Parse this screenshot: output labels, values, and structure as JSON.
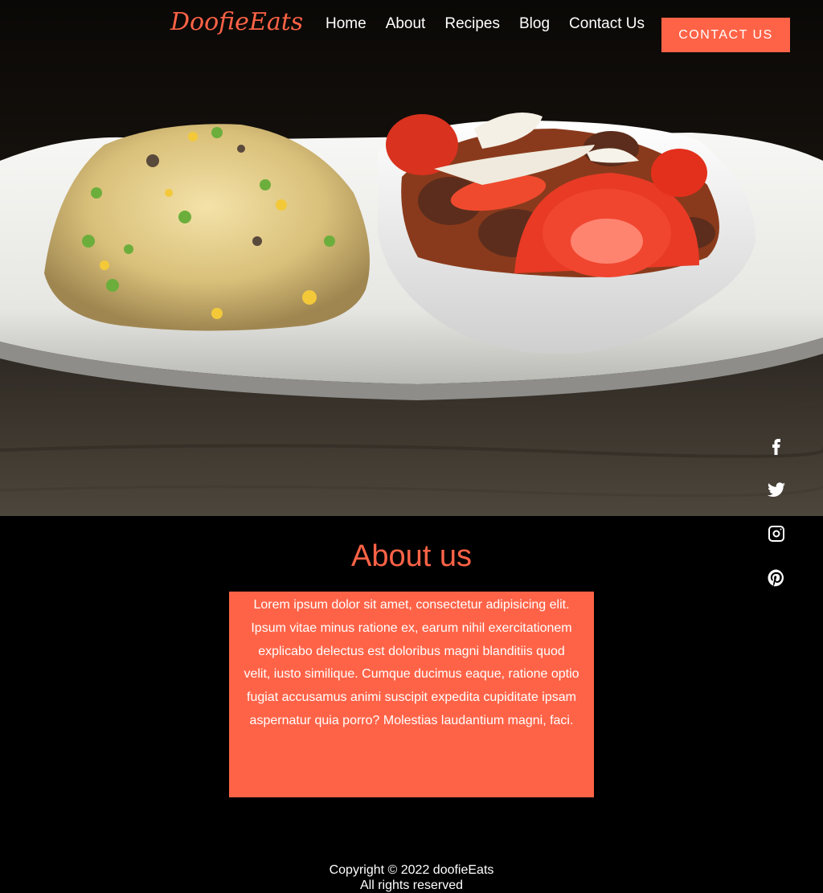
{
  "brand": {
    "logo": "DoofieEats",
    "accent_color": "#ff6347"
  },
  "nav": {
    "items": [
      {
        "label": "Home"
      },
      {
        "label": "About"
      },
      {
        "label": "Recipes"
      },
      {
        "label": "Blog"
      },
      {
        "label": "Contact Us"
      }
    ],
    "cta_label": "CONTACT US"
  },
  "hero": {
    "image": "plate of fried rice with meat stew and tomato slices"
  },
  "social": [
    {
      "icon": "facebook-icon"
    },
    {
      "icon": "twitter-icon"
    },
    {
      "icon": "instagram-icon"
    },
    {
      "icon": "pinterest-icon"
    }
  ],
  "about": {
    "title": "About us",
    "body": "Lorem ipsum dolor sit amet, consectetur adipisicing elit. Ipsum vitae minus ratione ex, earum nihil exercitationem explicabo delectus est doloribus magni blanditiis quod velit, iusto similique. Cumque ducimus eaque, ratione optio fugiat accusamus animi suscipit expedita cupiditate ipsam aspernatur quia porro? Molestias laudantium magni, faci."
  },
  "footer": {
    "copyright": "Copyright © 2022 doofieEats",
    "rights": "All rights reserved"
  }
}
